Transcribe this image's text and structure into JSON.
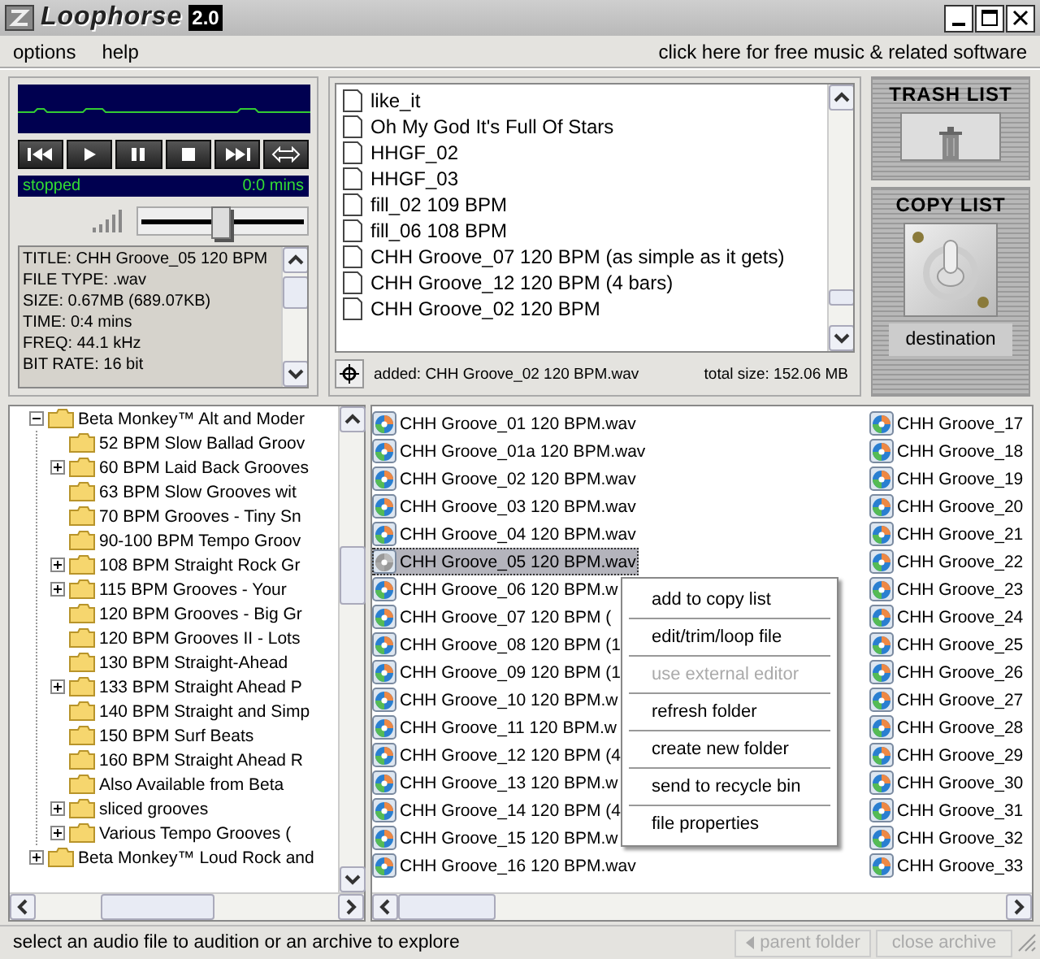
{
  "window": {
    "title": "Loophorse",
    "version": "2.0"
  },
  "menu": {
    "items": [
      "options",
      "help"
    ],
    "promo_link": "click here for free music & related software"
  },
  "player": {
    "status": "stopped",
    "time": "0:0 mins",
    "volume": {
      "level": 0.5
    },
    "info_lines": [
      "TITLE: CHH Groove_05 120 BPM",
      "FILE TYPE: .wav",
      "SIZE: 0.67MB (689.07KB)",
      "TIME: 0:4 mins",
      "FREQ: 44.1 kHz",
      "BIT RATE: 16 bit"
    ]
  },
  "copy_list": {
    "items": [
      "like_it",
      "Oh My God It's Full Of Stars",
      "HHGF_02",
      "HHGF_03",
      "fill_02 109 BPM",
      "fill_06 108 BPM",
      "CHH Groove_07 120 BPM (as simple as it gets)",
      "CHH Groove_12 120 BPM (4 bars)",
      "CHH Groove_02 120 BPM"
    ],
    "added": "added: CHH Groove_02 120 BPM.wav",
    "total_size": "total size: 152.06 MB"
  },
  "trash_list": {
    "title": "TRASH LIST"
  },
  "copy_target": {
    "title": "COPY LIST",
    "destination_button": "destination"
  },
  "tree": {
    "items": [
      {
        "label": "Beta Monkey™ Alt and Moder",
        "expandable": true,
        "expanded": true,
        "children": [
          {
            "label": "52 BPM Slow Ballad Groov",
            "expandable": false,
            "expanded": false
          },
          {
            "label": "60 BPM Laid Back Grooves",
            "expandable": true,
            "expanded": false
          },
          {
            "label": "63 BPM Slow Grooves wit",
            "expandable": false,
            "expanded": false
          },
          {
            "label": "70 BPM Grooves - Tiny Sn",
            "expandable": false,
            "expanded": false
          },
          {
            "label": "90-100 BPM Tempo Groov",
            "expandable": false,
            "expanded": false
          },
          {
            "label": "108 BPM Straight Rock Gr",
            "expandable": true,
            "expanded": false
          },
          {
            "label": "115 BPM Grooves - Your",
            "expandable": true,
            "expanded": false
          },
          {
            "label": "120 BPM Grooves - Big Gr",
            "expandable": false,
            "expanded": false
          },
          {
            "label": "120 BPM Grooves II - Lots",
            "expandable": false,
            "expanded": false
          },
          {
            "label": "130 BPM Straight-Ahead",
            "expandable": false,
            "expanded": false
          },
          {
            "label": "133 BPM Straight Ahead P",
            "expandable": true,
            "expanded": false
          },
          {
            "label": "140 BPM Straight and Simp",
            "expandable": false,
            "expanded": false
          },
          {
            "label": "150 BPM Surf Beats",
            "expandable": false,
            "expanded": false
          },
          {
            "label": "160 BPM Straight Ahead R",
            "expandable": false,
            "expanded": false
          },
          {
            "label": "Also Available from Beta",
            "expandable": false,
            "expanded": false
          },
          {
            "label": "sliced grooves",
            "expandable": true,
            "expanded": false
          },
          {
            "label": "Various Tempo Grooves (",
            "expandable": true,
            "expanded": false
          }
        ]
      },
      {
        "label": "Beta Monkey™ Loud Rock and",
        "expandable": true,
        "expanded": false
      }
    ]
  },
  "files": {
    "columns": [
      [
        {
          "name": "CHH Groove_01 120 BPM.wav",
          "selected": false
        },
        {
          "name": "CHH Groove_01a 120 BPM.wav",
          "selected": false
        },
        {
          "name": "CHH Groove_02 120 BPM.wav",
          "selected": false
        },
        {
          "name": "CHH Groove_03 120 BPM.wav",
          "selected": false
        },
        {
          "name": "CHH Groove_04 120 BPM.wav",
          "selected": false
        },
        {
          "name": "CHH Groove_05 120 BPM.wav",
          "selected": true
        },
        {
          "name": "CHH Groove_06 120 BPM.w",
          "selected": false
        },
        {
          "name": "CHH Groove_07 120 BPM (",
          "selected": false
        },
        {
          "name": "CHH Groove_08 120 BPM (1",
          "selected": false
        },
        {
          "name": "CHH Groove_09 120 BPM (1",
          "selected": false
        },
        {
          "name": "CHH Groove_10 120 BPM.w",
          "selected": false
        },
        {
          "name": "CHH Groove_11 120 BPM.w",
          "selected": false
        },
        {
          "name": "CHH Groove_12 120 BPM (4",
          "selected": false
        },
        {
          "name": "CHH Groove_13 120 BPM.w",
          "selected": false
        },
        {
          "name": "CHH Groove_14 120 BPM (4",
          "selected": false
        },
        {
          "name": "CHH Groove_15 120 BPM.w",
          "selected": false
        },
        {
          "name": "CHH Groove_16 120 BPM.wav",
          "selected": false
        }
      ],
      [
        {
          "name": "CHH Groove_17",
          "selected": false
        },
        {
          "name": "CHH Groove_18",
          "selected": false
        },
        {
          "name": "CHH Groove_19",
          "selected": false
        },
        {
          "name": "CHH Groove_20",
          "selected": false
        },
        {
          "name": "CHH Groove_21",
          "selected": false
        },
        {
          "name": "CHH Groove_22",
          "selected": false
        },
        {
          "name": "CHH Groove_23",
          "selected": false
        },
        {
          "name": "CHH Groove_24",
          "selected": false
        },
        {
          "name": "CHH Groove_25",
          "selected": false
        },
        {
          "name": "CHH Groove_26",
          "selected": false
        },
        {
          "name": "CHH Groove_27",
          "selected": false
        },
        {
          "name": "CHH Groove_28",
          "selected": false
        },
        {
          "name": "CHH Groove_29",
          "selected": false
        },
        {
          "name": "CHH Groove_30",
          "selected": false
        },
        {
          "name": "CHH Groove_31",
          "selected": false
        },
        {
          "name": "CHH Groove_32",
          "selected": false
        },
        {
          "name": "CHH Groove_33",
          "selected": false
        }
      ]
    ]
  },
  "context_menu": {
    "items": [
      {
        "label": "add to copy list",
        "disabled": false
      },
      {
        "label": "edit/trim/loop file",
        "disabled": false
      },
      {
        "label": "use external editor",
        "disabled": true
      },
      {
        "label": "refresh folder",
        "disabled": false
      },
      {
        "label": "create new folder",
        "disabled": false
      },
      {
        "label": "send to recycle bin",
        "disabled": false
      },
      {
        "label": "file properties",
        "disabled": false
      }
    ]
  },
  "status_bar": {
    "message": "select an audio file to audition or an archive to explore",
    "buttons": [
      {
        "label": "parent folder",
        "disabled": true,
        "kind": "back"
      },
      {
        "label": "close archive",
        "disabled": true,
        "kind": "plain"
      }
    ]
  }
}
